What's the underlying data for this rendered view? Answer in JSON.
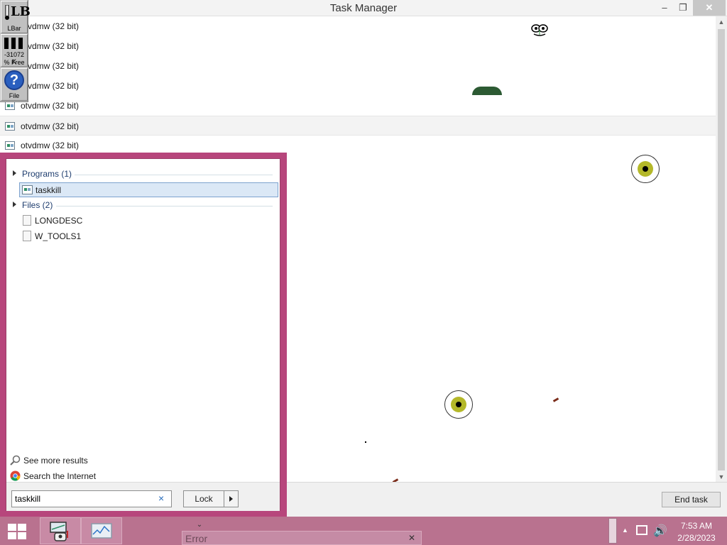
{
  "window": {
    "title": "Task Manager",
    "controls": {
      "minimize": "–",
      "maximize": "❐",
      "close": "✕"
    }
  },
  "processes": [
    {
      "label": "otvdmw (32 bit)",
      "selected": false
    },
    {
      "label": "otvdmw (32 bit)",
      "selected": false
    },
    {
      "label": "otvdmw (32 bit)",
      "selected": false
    },
    {
      "label": "otvdmw (32 bit)",
      "selected": false
    },
    {
      "label": "otvdmw (32 bit)",
      "selected": false
    },
    {
      "label": "otvdmw (32 bit)",
      "selected": true
    },
    {
      "label": "otvdmw (32 bit)",
      "selected": false
    }
  ],
  "footer": {
    "end_task": "End task"
  },
  "litebar": {
    "logo_mark": "LB",
    "logo_label": "LBar",
    "mem_value": "-31072 K",
    "mem_label": "% Free",
    "help_glyph": "?",
    "file_label": "File"
  },
  "search": {
    "groups": [
      {
        "label": "Programs (1)",
        "items": [
          {
            "label": "taskkill",
            "icon": "app-icon",
            "selected": true
          }
        ]
      },
      {
        "label": "Files (2)",
        "items": [
          {
            "label": "LONGDESC",
            "icon": "file-icon"
          },
          {
            "label": "W_TOOLS1",
            "icon": "file-icon"
          }
        ]
      }
    ],
    "see_more": "See more results",
    "search_internet": "Search the Internet",
    "query": "taskkill",
    "clear_glyph": "×",
    "power_button": "Lock"
  },
  "taskbar": {
    "error_window": "Error",
    "clock_time": "7:53 AM",
    "clock_date": "2/28/2023",
    "accent_color": "#b9728f"
  }
}
